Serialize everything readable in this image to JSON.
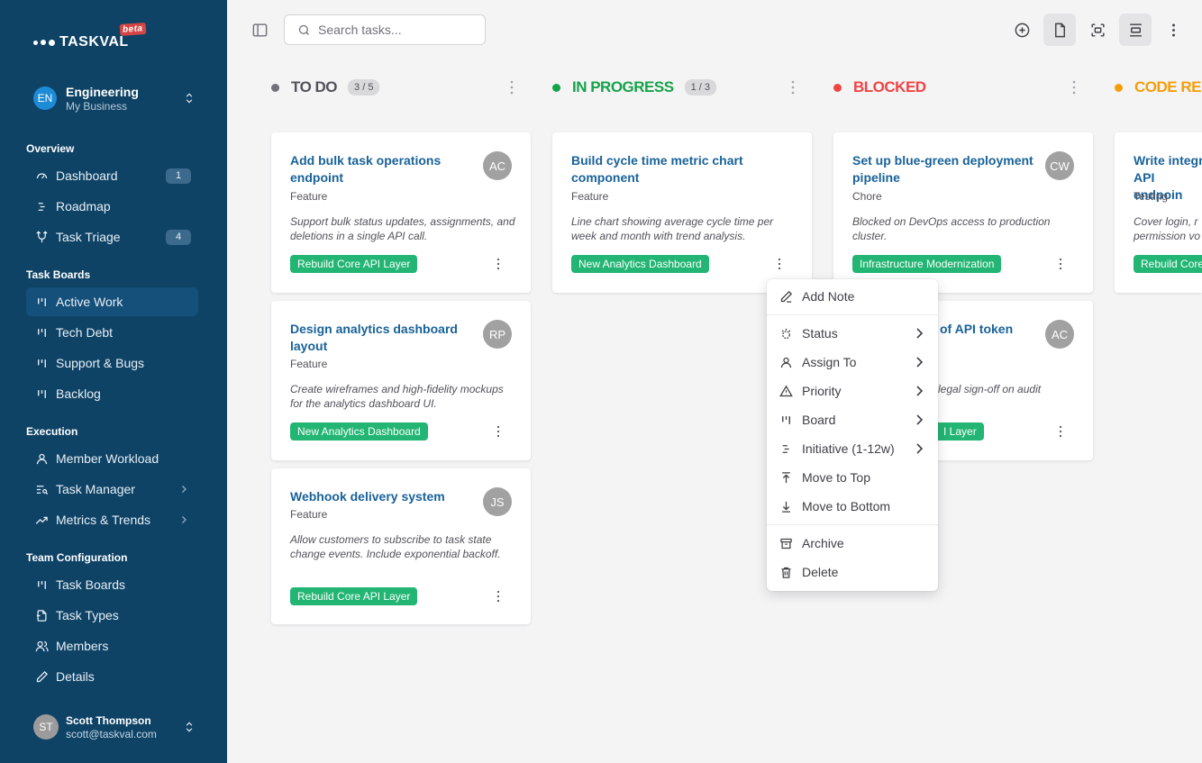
{
  "app": {
    "name": "TASKVAL",
    "badge": "beta"
  },
  "org": {
    "initials": "EN",
    "name": "Engineering",
    "sub": "My Business"
  },
  "sidebar": {
    "sections": [
      {
        "label": "Overview",
        "items": [
          {
            "label": "Dashboard",
            "icon": "gauge-icon",
            "badge": "1"
          },
          {
            "label": "Roadmap",
            "icon": "roadmap-icon"
          },
          {
            "label": "Task Triage",
            "icon": "triage-icon",
            "badge": "4"
          }
        ]
      },
      {
        "label": "Task Boards",
        "items": [
          {
            "label": "Active Work",
            "icon": "board-icon",
            "active": true
          },
          {
            "label": "Tech Debt",
            "icon": "board-icon"
          },
          {
            "label": "Support & Bugs",
            "icon": "board-icon"
          },
          {
            "label": "Backlog",
            "icon": "board-icon"
          }
        ]
      },
      {
        "label": "Execution",
        "items": [
          {
            "label": "Member Workload",
            "icon": "user-icon"
          },
          {
            "label": "Task Manager",
            "icon": "task-list-icon",
            "expandable": true
          },
          {
            "label": "Metrics & Trends",
            "icon": "trend-icon",
            "expandable": true
          }
        ]
      },
      {
        "label": "Team Configuration",
        "items": [
          {
            "label": "Task Boards",
            "icon": "board-icon"
          },
          {
            "label": "Task Types",
            "icon": "file-icon"
          },
          {
            "label": "Members",
            "icon": "users-icon"
          },
          {
            "label": "Details",
            "icon": "pencil-icon"
          }
        ]
      }
    ]
  },
  "user": {
    "initials": "ST",
    "name": "Scott Thompson",
    "email": "scott@taskval.com"
  },
  "search": {
    "placeholder": "Search tasks..."
  },
  "colors": {
    "todo": "#71717a",
    "in_progress": "#16a34a",
    "blocked": "#ef4444",
    "code_review": "#f59e0b",
    "tag": "#22b573",
    "sidebar": "#0e4366"
  },
  "columns": [
    {
      "title": "TO DO",
      "count": "3 / 5",
      "cards": [
        {
          "title": "Add bulk task operations endpoint",
          "type": "Feature",
          "desc": "Support bulk status updates, assignments, and deletions in a single API call.",
          "tag": "Rebuild Core API Layer",
          "assignee": "AC"
        },
        {
          "title": "Design analytics dashboard layout",
          "type": "Feature",
          "desc": "Create wireframes and high-fidelity mockups for the analytics dashboard UI.",
          "tag": "New Analytics Dashboard",
          "assignee": "RP"
        },
        {
          "title": "Webhook delivery system",
          "type": "Feature",
          "desc": "Allow customers to subscribe to task state change events. Include exponential backoff.",
          "tag": "Rebuild Core API Layer",
          "assignee": "JS"
        }
      ]
    },
    {
      "title": "IN PROGRESS",
      "count": "1 / 3",
      "cards": [
        {
          "title": "Build cycle time metric chart component",
          "type": "Feature",
          "desc": "Line chart showing average cycle time per week and month with trend analysis.",
          "tag": "New Analytics Dashboard"
        }
      ]
    },
    {
      "title": "BLOCKED",
      "cards": [
        {
          "title": "Set up blue-green deployment pipeline",
          "type": "Chore",
          "desc": "Blocked on DevOps access to production cluster.",
          "tag": "Infrastructure Modernization",
          "assignee": "CW"
        },
        {
          "title": "of API token",
          "desc": "legal sign-off on audit",
          "tag": "I Layer",
          "assignee": "AC"
        }
      ]
    },
    {
      "title": "CODE RE",
      "cards": [
        {
          "title": "Write integr API endpoin",
          "type": "Testing",
          "desc": "Cover login, r permission vo",
          "tag": "Rebuild Core"
        }
      ]
    }
  ],
  "context_menu": {
    "items": [
      {
        "label": "Add Note",
        "icon": "pencil-icon"
      },
      {
        "label": "Status",
        "icon": "status-icon",
        "submenu": true
      },
      {
        "label": "Assign To",
        "icon": "user-icon",
        "submenu": true
      },
      {
        "label": "Priority",
        "icon": "warning-icon",
        "submenu": true
      },
      {
        "label": "Board",
        "icon": "board-icon",
        "submenu": true
      },
      {
        "label": "Initiative (1-12w)",
        "icon": "initiative-icon",
        "submenu": true
      },
      {
        "label": "Move to Top",
        "icon": "arrow-up-to-line-icon"
      },
      {
        "label": "Move to Bottom",
        "icon": "arrow-down-to-line-icon"
      },
      {
        "label": "Archive",
        "icon": "archive-icon"
      },
      {
        "label": "Delete",
        "icon": "trash-icon"
      }
    ]
  }
}
